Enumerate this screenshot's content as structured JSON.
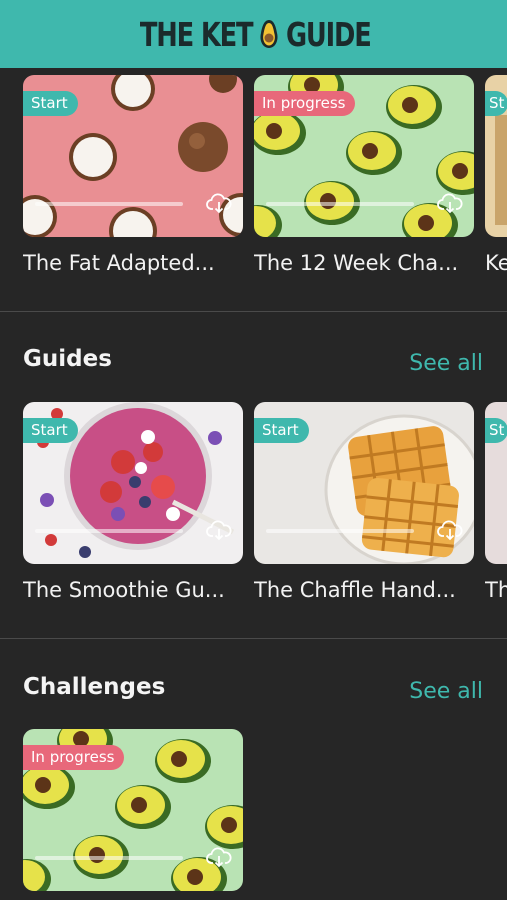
{
  "header": {
    "logo_text_left": "THE KET",
    "logo_text_right": "GUIDE"
  },
  "top_row": {
    "cards": [
      {
        "title": "The Fat Adapted...",
        "badge": "Start",
        "badge_type": "start",
        "progress": 0
      },
      {
        "title": "The 12 Week Cha...",
        "badge": "In progress",
        "badge_type": "progress",
        "progress": 0
      },
      {
        "title": "Ke",
        "badge": "St",
        "badge_type": "start",
        "progress": 0
      }
    ]
  },
  "guides": {
    "title": "Guides",
    "see_all": "See all",
    "cards": [
      {
        "title": "The Smoothie Gu...",
        "badge": "Start",
        "badge_type": "start",
        "progress": 0
      },
      {
        "title": "The Chaffle Hand...",
        "badge": "Start",
        "badge_type": "start",
        "progress": 0
      },
      {
        "title": "Th",
        "badge": "St",
        "badge_type": "start",
        "progress": 0
      }
    ]
  },
  "challenges": {
    "title": "Challenges",
    "see_all": "See all",
    "cards": [
      {
        "title": "",
        "badge": "In progress",
        "badge_type": "progress",
        "progress": 0
      }
    ]
  },
  "colors": {
    "accent": "#3fb8ad",
    "in_progress": "#e8687a",
    "background": "#262626"
  }
}
